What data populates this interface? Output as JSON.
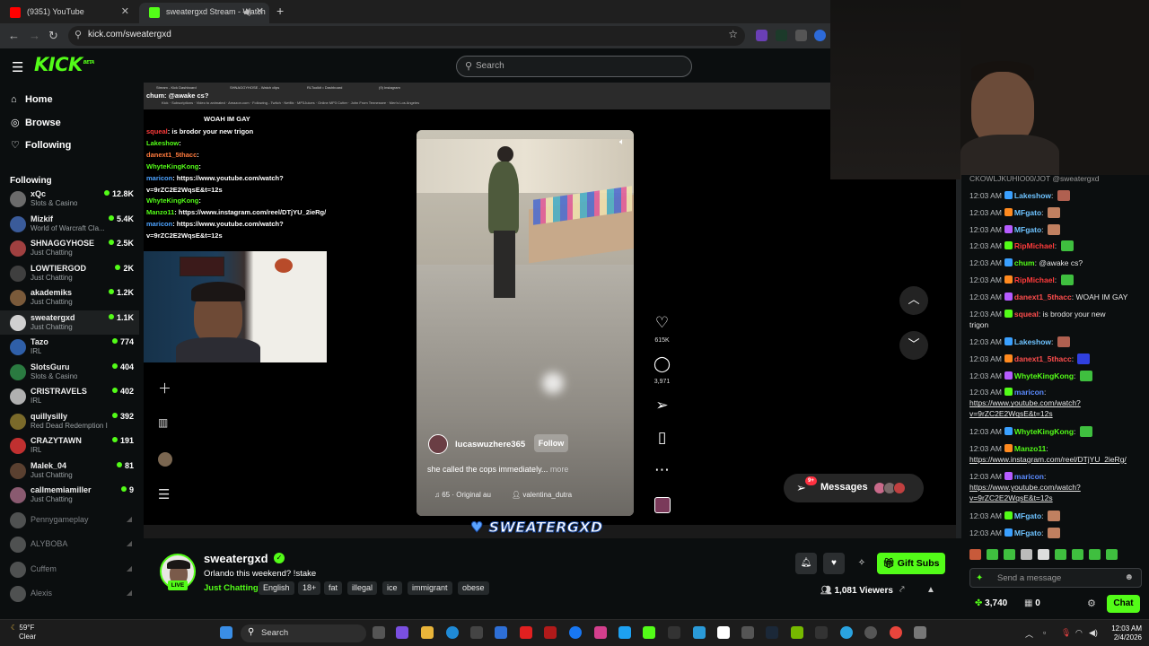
{
  "browser": {
    "tabs": [
      {
        "label": "(9351) YouTube"
      },
      {
        "label": "sweatergxd Stream - Watch"
      }
    ],
    "url": "kick.com/sweatergxd"
  },
  "kick": {
    "logo": "KICK",
    "logo_badge": "BETA",
    "search_placeholder": "Search",
    "nav": [
      {
        "label": "Home",
        "icon": "home-icon"
      },
      {
        "label": "Browse",
        "icon": "compass-icon"
      },
      {
        "label": "Following",
        "icon": "heart-icon"
      }
    ],
    "following_header": "Following",
    "channels": [
      {
        "name": "xQc",
        "category": "Slots & Casino",
        "viewers": "12.8K",
        "color": "#6b6b6b"
      },
      {
        "name": "Mizkif",
        "category": "World of Warcraft Cla...",
        "viewers": "5.4K",
        "color": "#3a5b9a"
      },
      {
        "name": "SHNAGGYHOSE",
        "category": "Just Chatting",
        "viewers": "2.5K",
        "color": "#a04040"
      },
      {
        "name": "LOWTIERGOD",
        "category": "Just Chatting",
        "viewers": "2K",
        "color": "#3f3f3f"
      },
      {
        "name": "akademiks",
        "category": "Just Chatting",
        "viewers": "1.2K",
        "color": "#7a5a3a"
      },
      {
        "name": "sweatergxd",
        "category": "Just Chatting",
        "viewers": "1.1K",
        "color": "#d0d0d0"
      },
      {
        "name": "Tazo",
        "category": "IRL",
        "viewers": "774",
        "color": "#2f5fa8"
      },
      {
        "name": "SlotsGuru",
        "category": "Slots & Casino",
        "viewers": "404",
        "color": "#2a7a40"
      },
      {
        "name": "CRISTRAVELS",
        "category": "IRL",
        "viewers": "402",
        "color": "#b0b0b0"
      },
      {
        "name": "quillysilly",
        "category": "Red Dead Redemption II",
        "viewers": "392",
        "color": "#7a6a2a"
      },
      {
        "name": "CRAZYTAWN",
        "category": "IRL",
        "viewers": "191",
        "color": "#c03030"
      },
      {
        "name": "Malek_04",
        "category": "Just Chatting",
        "viewers": "81",
        "color": "#5a4030"
      },
      {
        "name": "callmemiamiller",
        "category": "Just Chatting",
        "viewers": "9",
        "color": "#8a5a70"
      }
    ],
    "offline_channels": [
      {
        "name": "Pennygameplay"
      },
      {
        "name": "ALYBOBA"
      },
      {
        "name": "Cuffem"
      },
      {
        "name": "Alexis"
      }
    ]
  },
  "video": {
    "overlay_chat": [
      {
        "user": "squeal",
        "text": "is brodor your new trigon"
      },
      {
        "user": "Lakeshow",
        "text": ""
      },
      {
        "user": "danext1_5thacc",
        "text": ""
      },
      {
        "user": "WhyteKingKong",
        "text": ""
      },
      {
        "user": "maricon",
        "text": "https://www.youtube.com/watch?"
      },
      {
        "user": "",
        "text": "v=9rZC2E2WqsE&t=12s"
      },
      {
        "user": "WhyteKingKong",
        "text": ""
      },
      {
        "user": "Manzo11",
        "text": "https://www.instagram.com/reel/DTjYU_2ieRg/"
      },
      {
        "user": "maricon",
        "text": "https://www.youtube.com/watch?"
      },
      {
        "user": "",
        "text": "v=9rZC2E2WqsE&t=12s"
      }
    ],
    "overlay_top": "chum: @awake cs?",
    "overlay_top2": "WOAH IM GAY",
    "reel": {
      "username": "lucaswuzhere365",
      "follow": "Follow",
      "caption": "she called the cops immediately...",
      "more": "more",
      "audio": "65 · Original au",
      "creator": "valentina_dutra",
      "likes": "615K",
      "comments": "3,971"
    },
    "messages_label": "Messages",
    "messages_badge": "9+",
    "brand_text": "SWEATERGXD"
  },
  "stream": {
    "streamer": "sweatergxd",
    "live": "LIVE",
    "title": "Orlando this weekend? !stake",
    "category": "Just Chatting",
    "tags": [
      "English",
      "18+",
      "fat",
      "illegal",
      "ice",
      "immigrant",
      "obese"
    ],
    "gift_label": "Gift Subs",
    "viewers": "1,081 Viewers"
  },
  "chat": {
    "top_partial": "CKOWLJKUHIO00/JOT @sweatergxd",
    "messages": [
      {
        "time": "12:03 AM",
        "user": "Lakeshow",
        "ucolor": "b",
        "text": "",
        "emote": "#b06050"
      },
      {
        "time": "12:03 AM",
        "user": "MFgato",
        "ucolor": "b",
        "text": "",
        "emote": "#c08060"
      },
      {
        "time": "12:03 AM",
        "user": "MFgato",
        "ucolor": "b",
        "text": "",
        "emote": "#c08060"
      },
      {
        "time": "12:03 AM",
        "user": "RipMichael",
        "ucolor": "r",
        "text": "",
        "emote": "#3fbf3f"
      },
      {
        "time": "12:03 AM",
        "user": "chum",
        "ucolor": "g",
        "text": "@awake cs?",
        "emote": ""
      },
      {
        "time": "12:03 AM",
        "user": "RipMichael",
        "ucolor": "r",
        "text": "",
        "emote": "#3fbf3f"
      },
      {
        "time": "12:03 AM",
        "user": "danext1_5thacc",
        "ucolor": "rs",
        "text": "WOAH IM GAY",
        "emote": ""
      },
      {
        "time": "12:03 AM",
        "user": "squeal",
        "ucolor": "rs",
        "text": "is brodor your new",
        "text2": "trigon",
        "emote": ""
      },
      {
        "time": "12:03 AM",
        "user": "Lakeshow",
        "ucolor": "b",
        "text": "",
        "emote": "#b06050"
      },
      {
        "time": "12:03 AM",
        "user": "danext1_5thacc",
        "ucolor": "rs",
        "text": "",
        "emote": "#3040e0"
      },
      {
        "time": "12:03 AM",
        "user": "WhyteKingKong",
        "ucolor": "g",
        "text": "",
        "emote": "#3fbf3f"
      },
      {
        "time": "12:03 AM",
        "user": "maricon",
        "ucolor": "bl",
        "link": "https://www.youtube.com/watch?",
        "link2": "v=9rZC2E2WqsE&t=12s"
      },
      {
        "time": "12:03 AM",
        "user": "WhyteKingKong",
        "ucolor": "g",
        "text": "",
        "emote": "#3fbf3f"
      },
      {
        "time": "12:03 AM",
        "user": "Manzo11",
        "ucolor": "g",
        "link": "https://www.instagram.com/reel/DTjYU_2ieRg/"
      },
      {
        "time": "12:03 AM",
        "user": "maricon",
        "ucolor": "bl",
        "link": "https://www.youtube.com/watch?",
        "link2": "v=9rZC2E2WqsE&t=12s"
      },
      {
        "time": "12:03 AM",
        "user": "MFgato",
        "ucolor": "b",
        "text": "",
        "emote": "#c08060"
      },
      {
        "time": "12:03 AM",
        "user": "MFgato",
        "ucolor": "b",
        "text": "",
        "emote": "#c08060"
      }
    ],
    "send_placeholder": "Send a message",
    "points": "3,740",
    "points2": "0",
    "chat_button": "Chat"
  },
  "taskbar": {
    "temp": "59°F",
    "weather": "Clear",
    "search": "Search",
    "time": "12:03 AM",
    "date": "2/4/2026"
  },
  "colors": {
    "kick_green": "#53fc18",
    "bg": "#0b0e0f"
  }
}
